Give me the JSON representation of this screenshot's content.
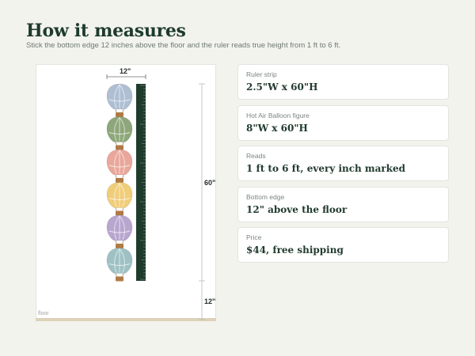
{
  "header": {
    "title": "How it measures",
    "subtitle": "Stick the bottom edge 12 inches above the floor and the ruler reads true height from 1 ft to 6 ft."
  },
  "diagram": {
    "width_label": "12\"",
    "height_label": "60\"",
    "offset_label": "12\"",
    "floor_label": "floor",
    "balloon_colors": [
      "#aebfd3",
      "#8ea77a",
      "#e9a79b",
      "#f0cd79",
      "#b8a6cf",
      "#9fc1c4"
    ],
    "ruler_color": "#1f3b2c"
  },
  "specs": [
    {
      "label": "Ruler strip",
      "value": "2.5\"W x 60\"H"
    },
    {
      "label": "Hot Air Balloon figure",
      "value": "8\"W x 60\"H"
    },
    {
      "label": "Reads",
      "value": "1 ft to 6 ft, every inch marked"
    },
    {
      "label": "Bottom edge",
      "value": "12\" above the floor"
    },
    {
      "label": "Price",
      "value": "$44, free shipping"
    }
  ]
}
